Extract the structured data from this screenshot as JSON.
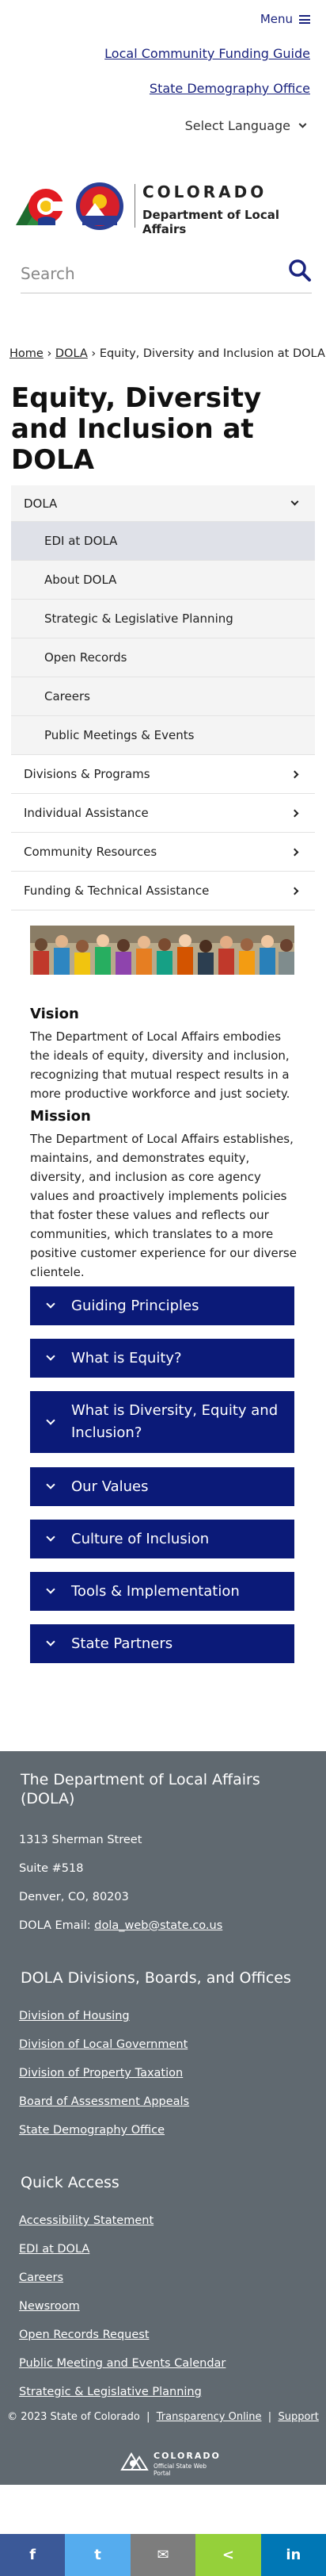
{
  "header": {
    "menu_label": "Menu",
    "link_funding": "Local Community Funding Guide",
    "link_demography": "State Demography Office",
    "language_label": "Select Language",
    "logo_colorado": "COLORADO",
    "logo_dept": "Department of Local Affairs",
    "logo_badge": "DOLA",
    "search_placeholder": "Search"
  },
  "breadcrumb": {
    "home": "Home",
    "sep1": "›",
    "dola": "DOLA",
    "sep2": "›",
    "current": "Equity, Diversity and Inclusion at DOLA"
  },
  "page_title": "Equity, Diversity and Inclusion at DOLA",
  "subnav": {
    "header": "DOLA",
    "children": [
      "EDI at DOLA",
      "About DOLA",
      "Strategic & Legislative Planning",
      "Open Records",
      "Careers",
      "Public Meetings & Events"
    ],
    "sections": [
      "Divisions & Programs",
      "Individual Assistance",
      "Community Resources",
      "Funding & Technical Assistance"
    ]
  },
  "content": {
    "vision_heading": "Vision",
    "vision_text": "The Department of Local Affairs embodies the ideals of equity, diversity and inclusion, recognizing that mutual respect results in a more productive workforce and just society.",
    "mission_heading": "Mission",
    "mission_text": "The Department of Local Affairs establishes, maintains, and demonstrates equity, diversity, and inclusion as core agency values and proactively implements policies that foster these values and reflects our communities, which translates to a more positive customer experience for our diverse clientele."
  },
  "accordions": [
    "Guiding Principles",
    "What is Equity?",
    "What is Diversity, Equity and Inclusion?",
    "Our Values",
    "Culture of Inclusion",
    "Tools & Implementation",
    "State Partners"
  ],
  "footer": {
    "org_name": "The Department of Local Affairs (DOLA)",
    "address1": "1313 Sherman Street",
    "address2": "Suite  #518",
    "address3": "Denver, CO, 80203",
    "email_label": "DOLA Email:",
    "email": "dola_web@state.co.us",
    "divisions_heading": "DOLA Divisions, Boards, and Offices",
    "divisions": [
      "Division of Housing",
      "Division of Local Government",
      "Division of Property Taxation",
      "Board of Assessment Appeals",
      "State Demography Office"
    ],
    "quick_heading": "Quick Access",
    "quick_links": [
      "Accessibility Statement",
      "EDI at DOLA",
      "Careers",
      "Newsroom",
      "Open Records Request",
      "Public Meeting and Events Calendar",
      "Strategic & Legislative Planning"
    ],
    "copyright": "© 2023 State of Colorado",
    "sep": "|",
    "transparency": "Transparency Online",
    "support": "Support",
    "portal_name": "COLORADO",
    "portal_sub": "Official State Web Portal"
  },
  "share": {
    "facebook": "f",
    "twitter": "t",
    "email": "✉",
    "share": "<",
    "linkedin": "in",
    "colors": [
      "#3b5998",
      "#55acee",
      "#7d7d7d",
      "#95d03a",
      "#0077b5"
    ]
  },
  "colors": {
    "accent": "#0b1a78",
    "footer_bg": "#606970"
  }
}
